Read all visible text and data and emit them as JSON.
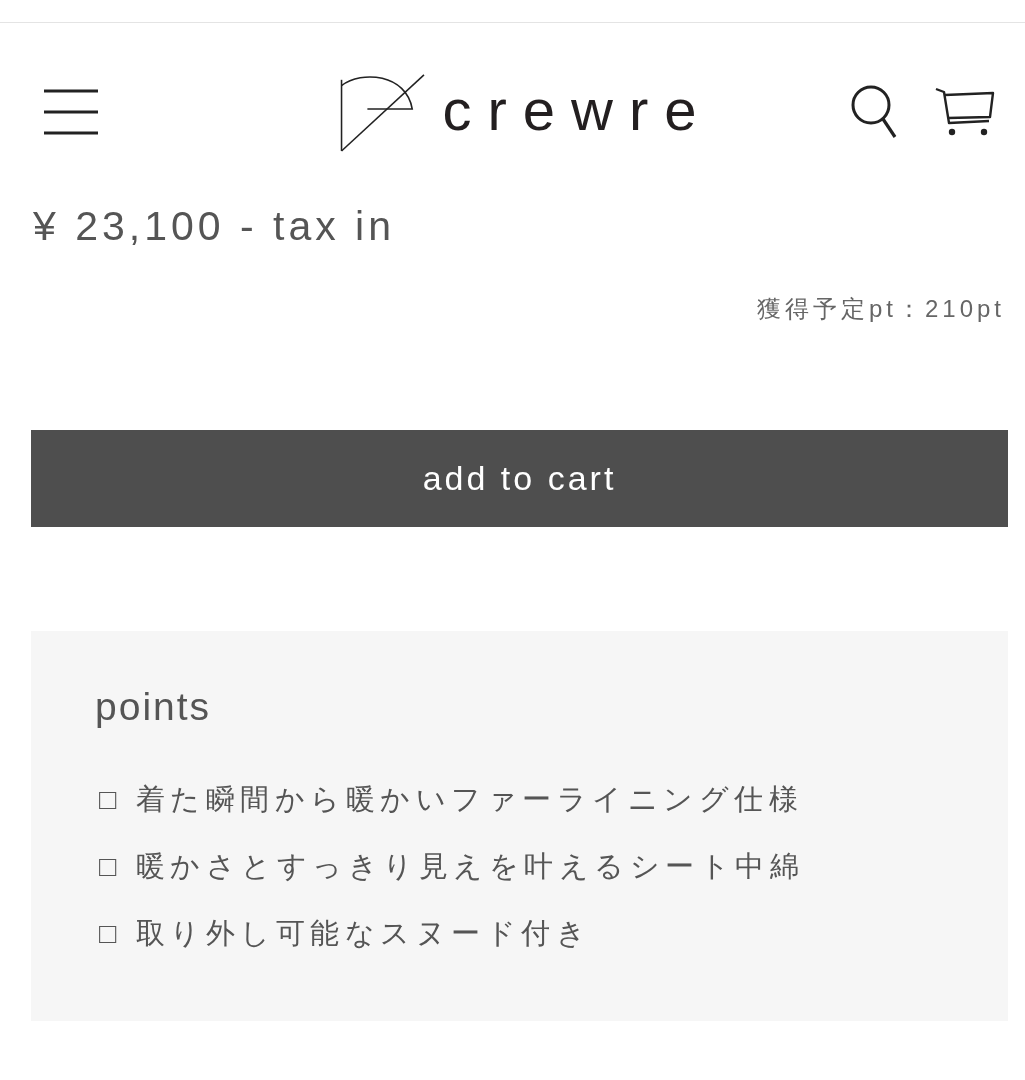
{
  "header": {
    "logo_text": "crewre"
  },
  "price": {
    "text": "¥ 23,100 - tax in",
    "points_note": "獲得予定pt：210pt"
  },
  "add_to_cart": {
    "label": "add to cart"
  },
  "points_panel": {
    "title": "points",
    "items": [
      "□ 着た瞬間から暖かいファーライニング仕様",
      "□ 暖かさとすっきり見えを叶えるシート中綿",
      "□ 取り外し可能なスヌード付き"
    ]
  }
}
